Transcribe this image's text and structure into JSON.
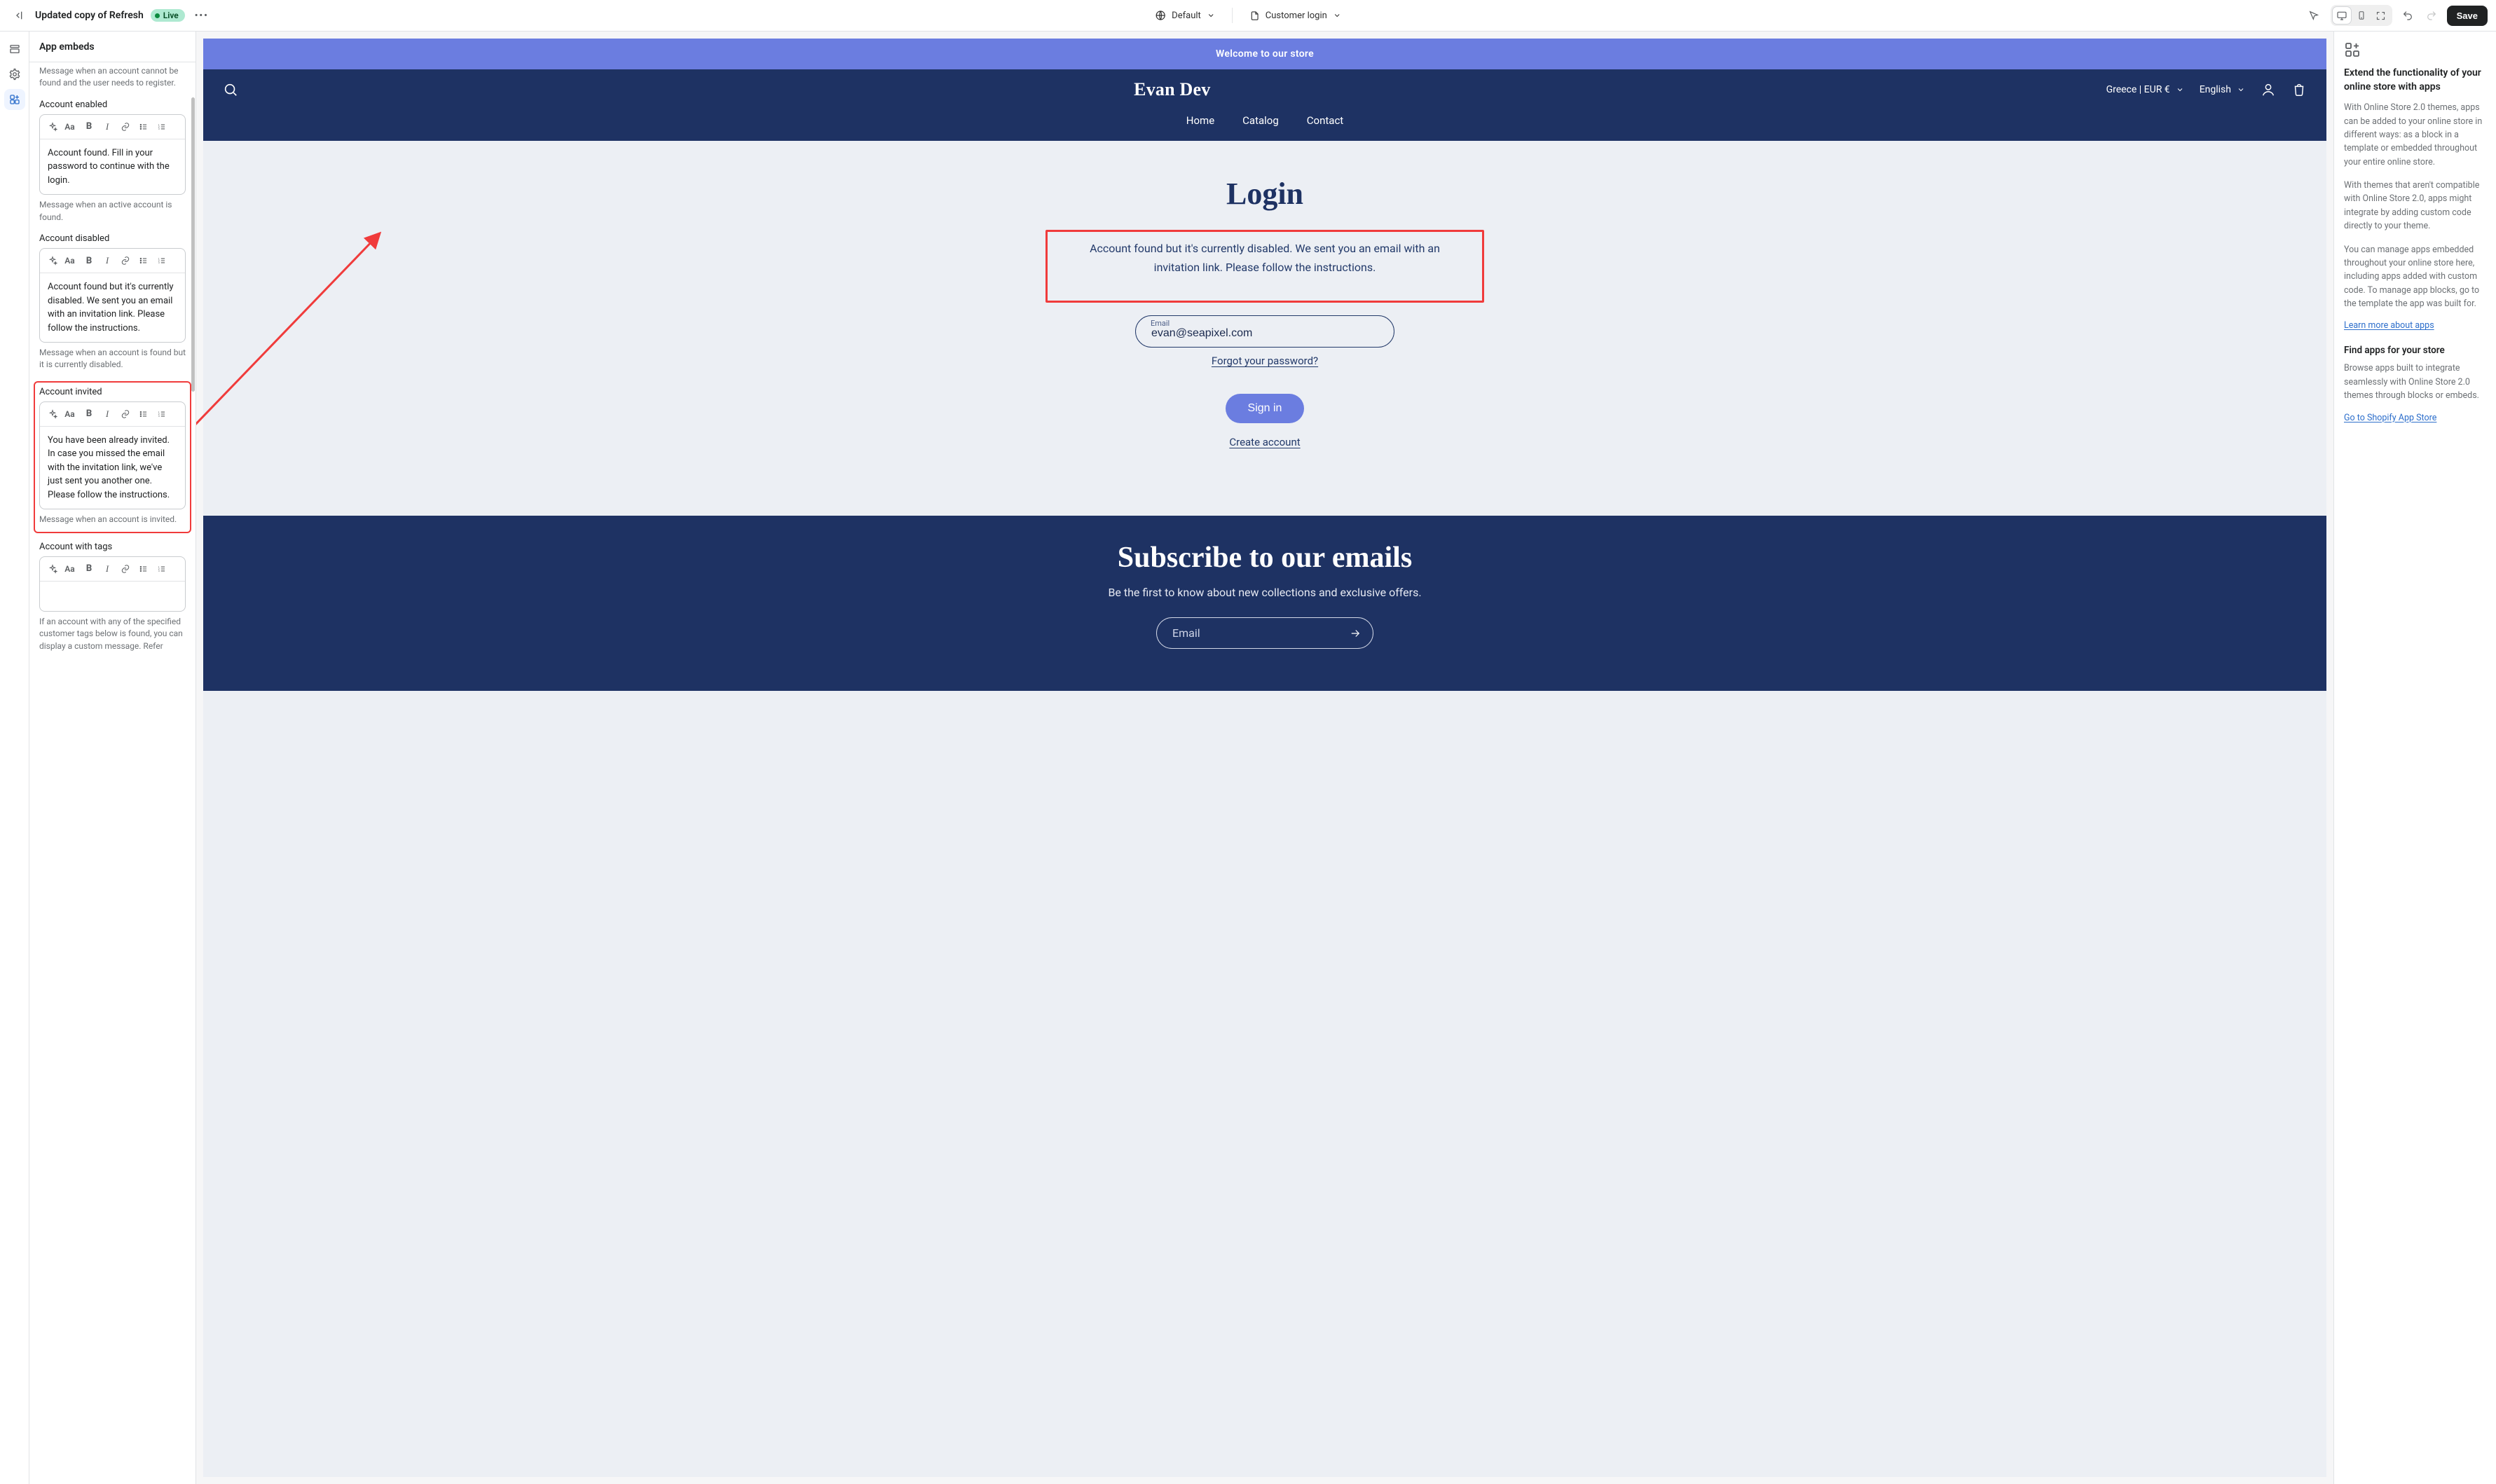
{
  "topbar": {
    "title": "Updated copy of Refresh",
    "live_badge": "Live",
    "locale_label": "Default",
    "template_label": "Customer login",
    "save_label": "Save"
  },
  "rail": {
    "items": [
      "sections-icon",
      "settings-icon",
      "app-embeds-icon"
    ]
  },
  "left": {
    "heading": "App embeds",
    "intro_help": "Message when an account cannot be found and the user needs to register.",
    "fields": {
      "enabled": {
        "label": "Account enabled",
        "text": "Account found. Fill in your password to continue with the login.",
        "help": "Message when an active account is found."
      },
      "disabled": {
        "label": "Account disabled",
        "text": "Account found but it's currently disabled. We sent you an email with an invitation link. Please follow the instructions.",
        "help": "Message when an account is found but it is currently disabled."
      },
      "invited": {
        "label": "Account invited",
        "text": "You have been already invited. In case you missed the email with the invitation link, we've just sent you another one. Please follow the instructions.",
        "help": "Message when an account is invited."
      },
      "tags": {
        "label": "Account with tags",
        "text": "",
        "help": "If an account with any of the specified customer tags below is found, you can display a custom message. Refer"
      }
    }
  },
  "preview": {
    "announcement": "Welcome to our store",
    "store_name": "Evan Dev",
    "country_currency": "Greece | EUR €",
    "language": "English",
    "nav": {
      "home": "Home",
      "catalog": "Catalog",
      "contact": "Contact"
    },
    "login": {
      "title": "Login",
      "message": "Account found but it's currently disabled. We sent you an email with an invitation link. Please follow the instructions.",
      "email_label": "Email",
      "email_value": "evan@seapixel.com",
      "forgot": "Forgot your password?",
      "signin": "Sign in",
      "create": "Create account"
    },
    "footer": {
      "title": "Subscribe to our emails",
      "sub": "Be the first to know about new collections and exclusive offers.",
      "email_placeholder": "Email"
    }
  },
  "right": {
    "heading": "Extend the functionality of your online store with apps",
    "p1": "With Online Store 2.0 themes, apps can be added to your online store in different ways: as a block in a template or embedded throughout your entire online store.",
    "p2": "With themes that aren't compatible with Online Store 2.0, apps might integrate by adding custom code directly to your theme.",
    "p3": "You can manage apps embedded throughout your online store here, including apps added with custom code. To manage app blocks, go to the template the app was built for.",
    "link1": "Learn more about apps",
    "sub_heading": "Find apps for your store",
    "p4": "Browse apps built to integrate seamlessly with Online Store 2.0 themes through blocks or embeds.",
    "link2": "Go to Shopify App Store"
  }
}
